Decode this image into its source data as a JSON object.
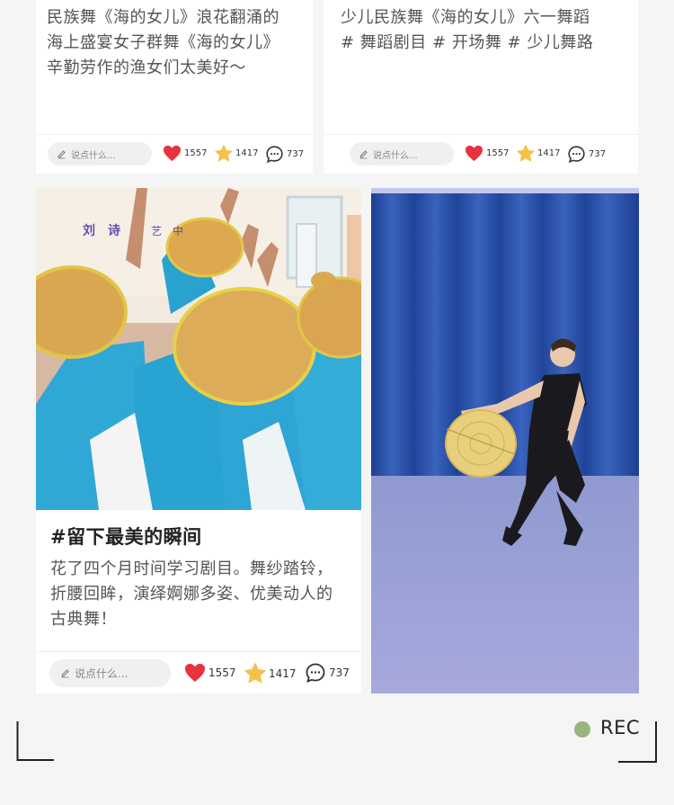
{
  "cards": {
    "top_left": {
      "text": [
        "民族舞《海的女儿》浪花翻涌的",
        "海上盛宴女子群舞《海的女儿》",
        "辛勤劳作的渔女们太美好～"
      ]
    },
    "top_right": {
      "text": [
        "少儿民族舞《海的女儿》六一舞蹈",
        "# 舞蹈剧目 # 开场舞 # 少儿舞路"
      ]
    },
    "feature": {
      "title": "#留下最美的瞬间",
      "text": [
        "花了四个月时间学习剧目。舞纱踏铃，",
        "折腰回眸，演绎婀娜多姿、优美动人的",
        "古典舞！"
      ]
    }
  },
  "actions": {
    "comment_placeholder": "说点什么...",
    "likes": "1557",
    "favorites": "1417",
    "comments": "737"
  },
  "photos": {
    "left_sign_text": [
      "刘",
      "诗",
      "艺",
      "中"
    ]
  },
  "footer": {
    "rec_label": "REC"
  },
  "colors": {
    "heart": "#e8323c",
    "star": "#f5c14d",
    "rec_dot": "#9bb47a"
  }
}
